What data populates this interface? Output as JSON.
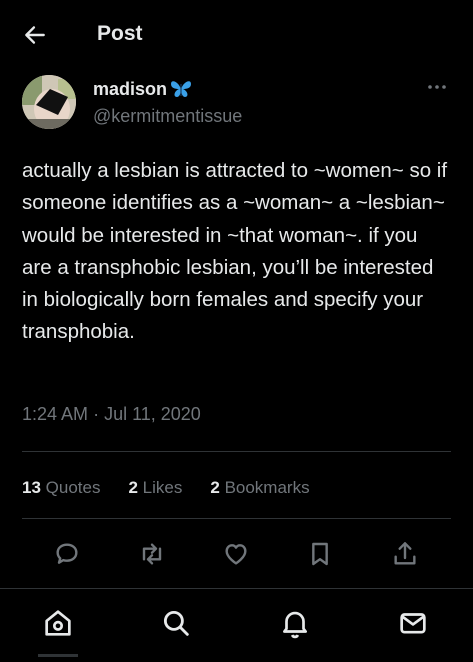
{
  "header": {
    "title": "Post"
  },
  "author": {
    "name": "madison",
    "handle": "@kermitmentissue"
  },
  "tweet": {
    "text": "actually a lesbian is attracted to ~women~ so if someone identifies as a ~woman~ a ~lesbian~ would be interested in ~that woman~. if you are a transphobic lesbian, you’ll be interested in biologically born females and specify your transphobia.",
    "time": "1:24 AM",
    "sep": "·",
    "date": "Jul 11, 2020"
  },
  "stats": {
    "quotes_count": "13",
    "quotes_label": "Quotes",
    "likes_count": "2",
    "likes_label": "Likes",
    "bookmarks_count": "2",
    "bookmarks_label": "Bookmarks"
  },
  "actions": [
    "reply-icon",
    "repost-icon",
    "like-icon",
    "bookmark-icon",
    "share-icon"
  ],
  "nav": [
    "home-icon",
    "search-icon",
    "notifications-icon",
    "messages-icon"
  ],
  "colors": {
    "background": "#000000",
    "text": "#e7e9ea",
    "muted": "#71767b",
    "divider": "#2f3336",
    "butterfly": "#1d9bf0"
  }
}
